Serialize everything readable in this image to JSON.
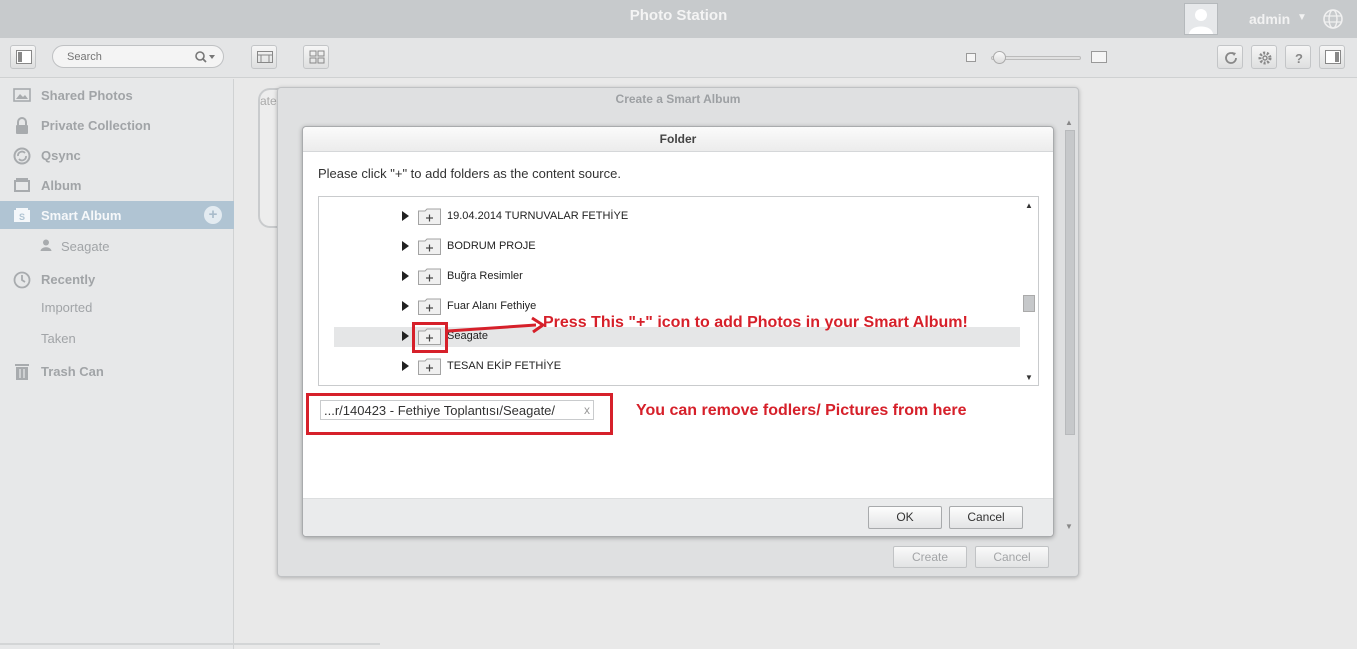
{
  "app": {
    "title": "Photo Station",
    "user": "admin",
    "user_caret": "▼"
  },
  "toolbar": {
    "search_placeholder": "Search"
  },
  "sidebar": {
    "items": [
      {
        "label": "Shared Photos"
      },
      {
        "label": "Private Collection"
      },
      {
        "label": "Qsync"
      },
      {
        "label": "Album"
      },
      {
        "label": "Smart Album",
        "add": "+"
      },
      {
        "label": "Seagate"
      },
      {
        "label": "Recently"
      },
      {
        "label": "Imported"
      },
      {
        "label": "Taken"
      },
      {
        "label": "Trash Can"
      }
    ]
  },
  "content": {
    "stub_text": "ate"
  },
  "outer_dialog": {
    "title": "Create a Smart Album",
    "create_label": "Create",
    "cancel_label": "Cancel"
  },
  "folder_dialog": {
    "title": "Folder",
    "instruction": "Please click \"+\" to add folders as the content source.",
    "folders": [
      {
        "name": "19.04.2014 TURNUVALAR FETHİYE"
      },
      {
        "name": "BODRUM PROJE"
      },
      {
        "name": "Buğra Resimler"
      },
      {
        "name": "Fuar Alanı Fethiye"
      },
      {
        "name": "Seagate"
      },
      {
        "name": "TESAN EKİP FETHİYE"
      }
    ],
    "selected_path": "...r/140423 - Fethiye Toplantısı/Seagate/",
    "remove_label": "x",
    "ok_label": "OK",
    "cancel_label": "Cancel"
  },
  "annotations": {
    "press_plus": "Press This \"+\" icon to add Photos in your Smart Album!",
    "remove_hint": "You can remove fodlers/ Pictures from here"
  },
  "colors": {
    "annotation_red": "#d6202a",
    "active_nav": "#b0c4d3"
  }
}
